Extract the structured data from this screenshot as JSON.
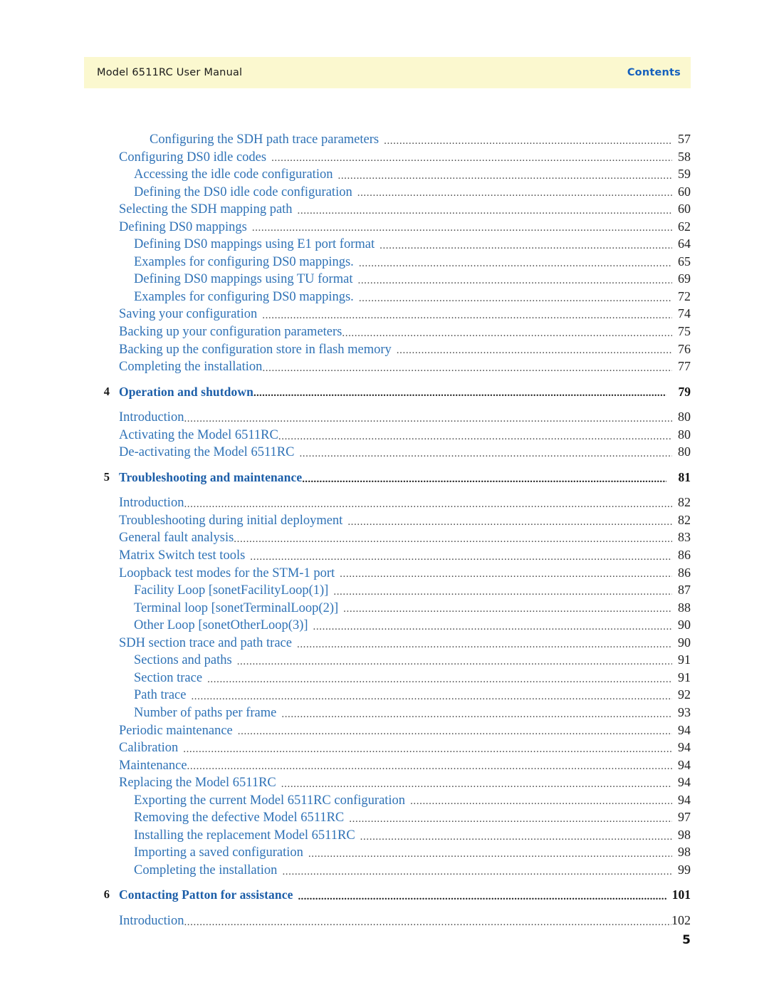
{
  "header": {
    "manual_title": "Model 6511RC User Manual",
    "section_label": "Contents",
    "banner_color": "#fbf8cf",
    "section_color": "#1560bd"
  },
  "colors": {
    "entry_blue": "#2f72b6",
    "chapter_blue": "#1c5ea8",
    "page_number": "#1f1f1f"
  },
  "footer": {
    "folio": "5"
  },
  "toc": {
    "entries": [
      {
        "level": 3,
        "label": "Configuring the SDH path trace parameters",
        "page": "57",
        "gap": true
      },
      {
        "level": 1,
        "label": "Configuring DS0 idle codes",
        "page": "58",
        "gap": true
      },
      {
        "level": 2,
        "label": "Accessing the idle code configuration",
        "page": "59",
        "gap": true
      },
      {
        "level": 2,
        "label": "Defining the DS0 idle code configuration",
        "page": "60",
        "gap": true
      },
      {
        "level": 1,
        "label": "Selecting the SDH mapping path",
        "page": "60",
        "gap": true
      },
      {
        "level": 1,
        "label": "Defining DS0 mappings",
        "page": "62",
        "gap": true
      },
      {
        "level": 2,
        "label": "Defining DS0 mappings using E1 port format",
        "page": "64",
        "gap": true
      },
      {
        "level": 2,
        "label": "Examples for configuring DS0 mappings.",
        "page": "65",
        "gap": true
      },
      {
        "level": 2,
        "label": "Defining DS0 mappings using TU format",
        "page": "69",
        "gap": true
      },
      {
        "level": 2,
        "label": "Examples for configuring DS0 mappings.",
        "page": "72",
        "gap": true
      },
      {
        "level": 1,
        "label": "Saving your configuration",
        "page": "74",
        "gap": true
      },
      {
        "level": 0,
        "label": "Backing up your configuration parameters",
        "page": "75",
        "gap": false
      },
      {
        "level": 1,
        "label": "Backing up the configuration store in flash memory",
        "page": "76",
        "gap": true
      },
      {
        "level": 0,
        "label": "Completing the installation",
        "page": "77",
        "gap": false
      },
      {
        "chapter": "4",
        "level": 0,
        "label": "Operation and shutdown",
        "page": "79",
        "gap": false
      },
      {
        "level": 0,
        "label": "Introduction",
        "page": "80",
        "gap": false
      },
      {
        "level": 0,
        "label": "Activating the Model 6511RC",
        "page": "80",
        "gap": false
      },
      {
        "level": 0,
        "label": "De-activating the Model 6511RC",
        "page": "80",
        "gap": true
      },
      {
        "chapter": "5",
        "level": 0,
        "label": "Troubleshooting and maintenance",
        "page": "81",
        "gap": false
      },
      {
        "level": 0,
        "label": "Introduction",
        "page": "82",
        "gap": false
      },
      {
        "level": 0,
        "label": "Troubleshooting during initial deployment",
        "page": "82",
        "gap": true
      },
      {
        "level": 0,
        "label": "General fault analysis",
        "page": "83",
        "gap": false
      },
      {
        "level": 0,
        "label": "Matrix Switch test tools",
        "page": "86",
        "gap": true
      },
      {
        "level": 1,
        "label": "Loopback test modes for the STM-1 port",
        "page": "86",
        "gap": true
      },
      {
        "level": 2,
        "label": "Facility Loop [sonetFacilityLoop(1)]",
        "page": "87",
        "gap": true
      },
      {
        "level": 2,
        "label": "Terminal loop [sonetTerminalLoop(2)]",
        "page": "88",
        "gap": true
      },
      {
        "level": 2,
        "label": "Other Loop [sonetOtherLoop(3)]",
        "page": "90",
        "gap": true
      },
      {
        "level": 1,
        "label": "SDH section trace and path trace",
        "page": "90",
        "gap": true
      },
      {
        "level": 2,
        "label": "Sections and paths",
        "page": "91",
        "gap": true
      },
      {
        "level": 2,
        "label": "Section trace",
        "page": "91",
        "gap": true
      },
      {
        "level": 2,
        "label": "Path trace",
        "page": "92",
        "gap": true
      },
      {
        "level": 2,
        "label": "Number of paths per frame",
        "page": "93",
        "gap": true
      },
      {
        "level": 0,
        "label": "Periodic maintenance",
        "page": "94",
        "gap": true
      },
      {
        "level": 1,
        "label": "Calibration",
        "page": "94",
        "gap": true
      },
      {
        "level": 0,
        "label": "Maintenance",
        "page": "94",
        "gap": false
      },
      {
        "level": 1,
        "label": "Replacing the Model 6511RC",
        "page": "94",
        "gap": true
      },
      {
        "level": 2,
        "label": "Exporting the current Model 6511RC configuration",
        "page": "94",
        "gap": true
      },
      {
        "level": 2,
        "label": "Removing the defective Model 6511RC",
        "page": "97",
        "gap": true
      },
      {
        "level": 2,
        "label": "Installing the replacement Model 6511RC",
        "page": "98",
        "gap": true
      },
      {
        "level": 2,
        "label": "Importing a saved configuration",
        "page": "98",
        "gap": true
      },
      {
        "level": 2,
        "label": "Completing the installation",
        "page": "99",
        "gap": true
      },
      {
        "chapter": "6",
        "level": 0,
        "label": "Contacting Patton for assistance",
        "page": "101",
        "gap": true
      },
      {
        "level": 0,
        "label": "Introduction",
        "page": "102",
        "gap": false
      }
    ]
  }
}
